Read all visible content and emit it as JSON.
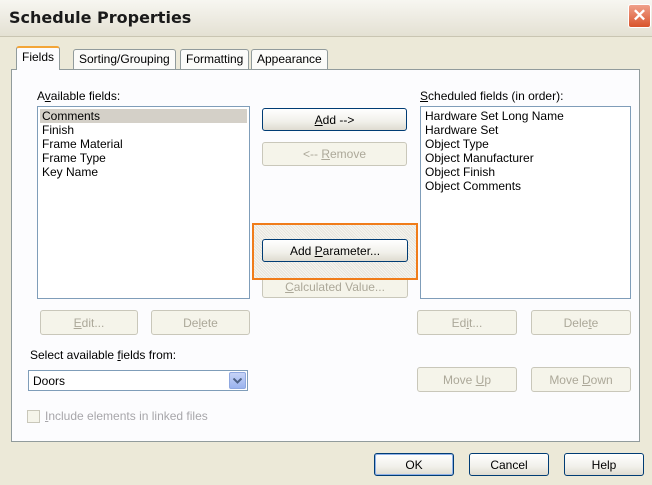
{
  "window": {
    "title": "Schedule Properties",
    "close_glyph": "✕"
  },
  "tabs": [
    {
      "label": "Fields",
      "active": true
    },
    {
      "label": "Sorting/Grouping",
      "active": false
    },
    {
      "label": "Formatting",
      "active": false
    },
    {
      "label": "Appearance",
      "active": false
    }
  ],
  "available": {
    "label_pre": "A",
    "label_u": "v",
    "label_post": "ailable fields:",
    "items": [
      "Comments",
      "Finish",
      "Frame Material",
      "Frame Type",
      "Key Name"
    ],
    "selected_index": 0
  },
  "scheduled": {
    "label_pre": "",
    "label_u": "S",
    "label_post": "cheduled fields (in order):",
    "items": [
      "Hardware Set Long Name",
      "Hardware Set",
      "Object Type",
      "Object Manufacturer",
      "Object Finish",
      "Object Comments"
    ]
  },
  "buttons": {
    "add": {
      "u": "A",
      "rest": "dd -->"
    },
    "remove": {
      "pre": "<-- ",
      "u": "R",
      "rest": "emove"
    },
    "add_parameter": {
      "pre": "Add ",
      "u": "P",
      "rest": "arameter..."
    },
    "calculated_value": {
      "u": "C",
      "rest": "alculated Value..."
    },
    "edit_left": {
      "u": "E",
      "rest": "dit..."
    },
    "delete_left": {
      "pre": "De",
      "u": "l",
      "rest": "ete"
    },
    "edit_right": {
      "pre": "Ed",
      "u": "i",
      "rest": "t..."
    },
    "delete_right": {
      "pre": "Dele",
      "u": "t",
      "rest": "e"
    },
    "move_up": {
      "pre": "Move ",
      "u": "U",
      "rest": "p"
    },
    "move_down": {
      "pre": "Move ",
      "u": "D",
      "rest": "own"
    },
    "ok": "OK",
    "cancel": "Cancel",
    "help": "Help"
  },
  "select_from": {
    "label_pre": "Select available ",
    "label_u": "f",
    "label_post": "ields from:",
    "value": "Doors"
  },
  "include_linked": {
    "u": "I",
    "rest": "nclude elements in linked files",
    "checked": false
  },
  "colors": {
    "highlight_border": "#f07c1a",
    "tab_active_accent": "#f3a537",
    "close_button": "#d9542c"
  }
}
